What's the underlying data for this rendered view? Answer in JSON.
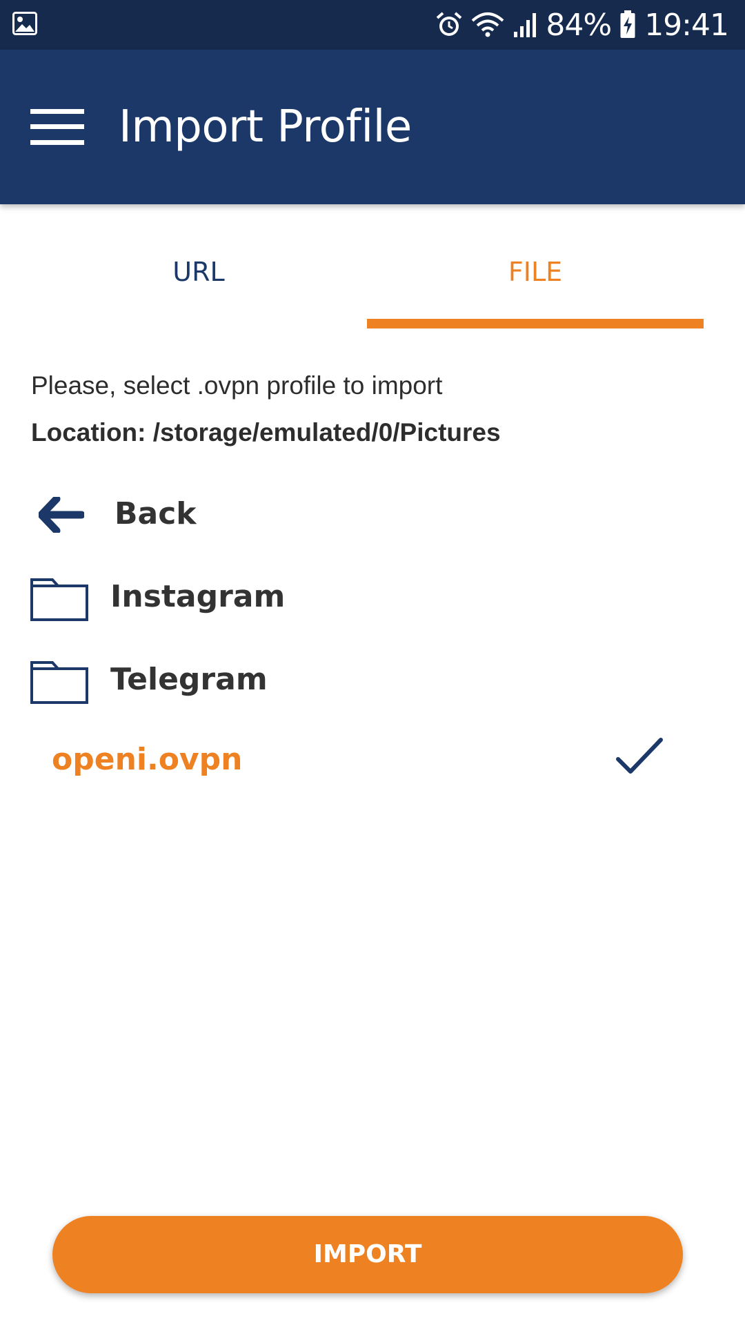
{
  "status_bar": {
    "battery": "84%",
    "time": "19:41",
    "icons": [
      "gallery-icon",
      "alarm-icon",
      "wifi-icon",
      "signal-icon",
      "battery-charging-icon"
    ]
  },
  "app_bar": {
    "title": "Import Profile",
    "menu_icon": "hamburger-menu-icon"
  },
  "tabs": [
    {
      "label": "URL",
      "selected": false
    },
    {
      "label": "FILE",
      "selected": true
    }
  ],
  "content": {
    "instruction": "Please, select .ovpn profile to import",
    "location": "Location: /storage/emulated/0/Pictures"
  },
  "file_list": {
    "back": {
      "label": "Back",
      "icon": "arrow-left-icon"
    },
    "folders": [
      {
        "label": "Instagram",
        "icon": "folder-icon"
      },
      {
        "label": "Telegram",
        "icon": "folder-icon"
      }
    ],
    "selected_file": {
      "label": "openi.ovpn",
      "icon": "checkmark-icon",
      "selected": true
    }
  },
  "import_button": {
    "label": "IMPORT"
  },
  "colors": {
    "status_bar": "#162a4e",
    "app_bar": "#1c3868",
    "accent": "#ee8122",
    "text": "#2d2d2d"
  }
}
